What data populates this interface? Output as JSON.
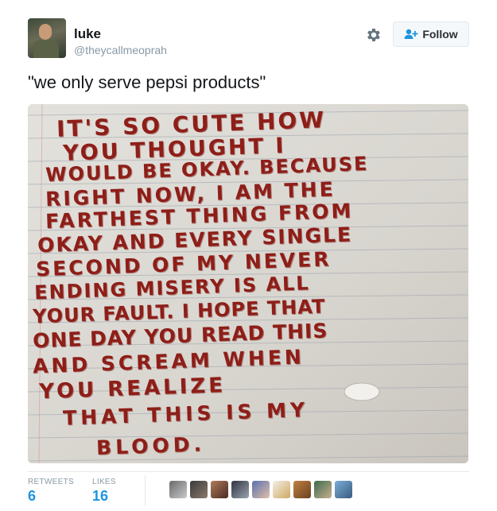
{
  "user": {
    "name": "luke",
    "handle": "@theycallmeoprah"
  },
  "follow_button": {
    "label": "Follow",
    "icon": "person-add-icon"
  },
  "settings": {
    "icon": "gear-icon"
  },
  "tweet": {
    "text": "\"we only serve pepsi products\""
  },
  "note_lines": [
    "IT'S SO CUTE HOW",
    "YOU THOUGHT I",
    "WOULD BE OKAY. BECAUSE",
    "RIGHT NOW, I AM THE",
    "FARTHEST THING FROM",
    "OKAY AND EVERY SINGLE",
    "SECOND OF MY NEVER",
    "ENDING MISERY IS ALL",
    "YOUR FAULT. I HOPE THAT",
    "ONE DAY YOU READ THIS",
    "AND SCREAM WHEN",
    "YOU REALIZE",
    "THAT THIS IS MY",
    "BLOOD."
  ],
  "stats": {
    "retweets_label": "RETWEETS",
    "retweets": "6",
    "likes_label": "LIKES",
    "likes": "16"
  },
  "colors": {
    "accent": "#1b95e0",
    "ink": "#8e1e18"
  }
}
